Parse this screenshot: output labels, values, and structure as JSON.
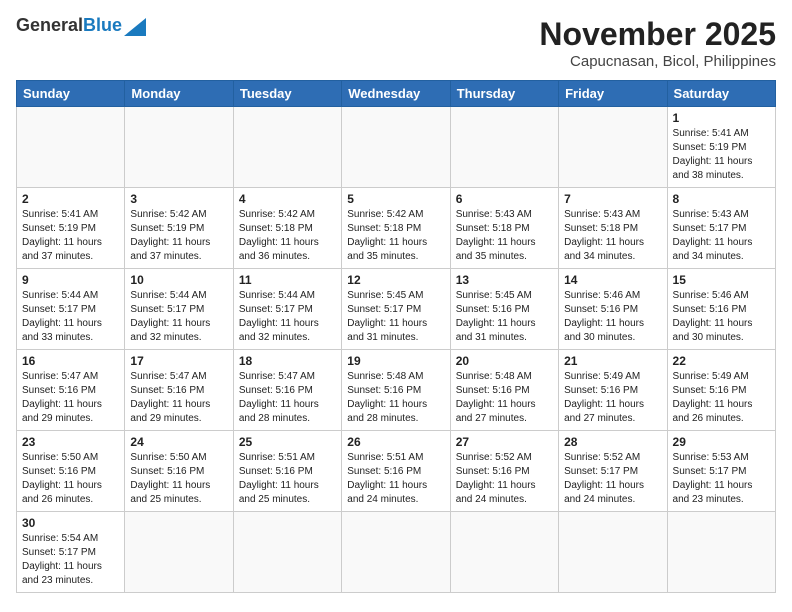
{
  "header": {
    "logo_line1": "General",
    "logo_line2": "Blue",
    "title": "November 2025",
    "subtitle": "Capucnasan, Bicol, Philippines"
  },
  "weekdays": [
    "Sunday",
    "Monday",
    "Tuesday",
    "Wednesday",
    "Thursday",
    "Friday",
    "Saturday"
  ],
  "weeks": [
    [
      {
        "day": "",
        "text": ""
      },
      {
        "day": "",
        "text": ""
      },
      {
        "day": "",
        "text": ""
      },
      {
        "day": "",
        "text": ""
      },
      {
        "day": "",
        "text": ""
      },
      {
        "day": "",
        "text": ""
      },
      {
        "day": "1",
        "text": "Sunrise: 5:41 AM\nSunset: 5:19 PM\nDaylight: 11 hours and 38 minutes."
      }
    ],
    [
      {
        "day": "2",
        "text": "Sunrise: 5:41 AM\nSunset: 5:19 PM\nDaylight: 11 hours and 37 minutes."
      },
      {
        "day": "3",
        "text": "Sunrise: 5:42 AM\nSunset: 5:19 PM\nDaylight: 11 hours and 37 minutes."
      },
      {
        "day": "4",
        "text": "Sunrise: 5:42 AM\nSunset: 5:18 PM\nDaylight: 11 hours and 36 minutes."
      },
      {
        "day": "5",
        "text": "Sunrise: 5:42 AM\nSunset: 5:18 PM\nDaylight: 11 hours and 35 minutes."
      },
      {
        "day": "6",
        "text": "Sunrise: 5:43 AM\nSunset: 5:18 PM\nDaylight: 11 hours and 35 minutes."
      },
      {
        "day": "7",
        "text": "Sunrise: 5:43 AM\nSunset: 5:18 PM\nDaylight: 11 hours and 34 minutes."
      },
      {
        "day": "8",
        "text": "Sunrise: 5:43 AM\nSunset: 5:17 PM\nDaylight: 11 hours and 34 minutes."
      }
    ],
    [
      {
        "day": "9",
        "text": "Sunrise: 5:44 AM\nSunset: 5:17 PM\nDaylight: 11 hours and 33 minutes."
      },
      {
        "day": "10",
        "text": "Sunrise: 5:44 AM\nSunset: 5:17 PM\nDaylight: 11 hours and 32 minutes."
      },
      {
        "day": "11",
        "text": "Sunrise: 5:44 AM\nSunset: 5:17 PM\nDaylight: 11 hours and 32 minutes."
      },
      {
        "day": "12",
        "text": "Sunrise: 5:45 AM\nSunset: 5:17 PM\nDaylight: 11 hours and 31 minutes."
      },
      {
        "day": "13",
        "text": "Sunrise: 5:45 AM\nSunset: 5:16 PM\nDaylight: 11 hours and 31 minutes."
      },
      {
        "day": "14",
        "text": "Sunrise: 5:46 AM\nSunset: 5:16 PM\nDaylight: 11 hours and 30 minutes."
      },
      {
        "day": "15",
        "text": "Sunrise: 5:46 AM\nSunset: 5:16 PM\nDaylight: 11 hours and 30 minutes."
      }
    ],
    [
      {
        "day": "16",
        "text": "Sunrise: 5:47 AM\nSunset: 5:16 PM\nDaylight: 11 hours and 29 minutes."
      },
      {
        "day": "17",
        "text": "Sunrise: 5:47 AM\nSunset: 5:16 PM\nDaylight: 11 hours and 29 minutes."
      },
      {
        "day": "18",
        "text": "Sunrise: 5:47 AM\nSunset: 5:16 PM\nDaylight: 11 hours and 28 minutes."
      },
      {
        "day": "19",
        "text": "Sunrise: 5:48 AM\nSunset: 5:16 PM\nDaylight: 11 hours and 28 minutes."
      },
      {
        "day": "20",
        "text": "Sunrise: 5:48 AM\nSunset: 5:16 PM\nDaylight: 11 hours and 27 minutes."
      },
      {
        "day": "21",
        "text": "Sunrise: 5:49 AM\nSunset: 5:16 PM\nDaylight: 11 hours and 27 minutes."
      },
      {
        "day": "22",
        "text": "Sunrise: 5:49 AM\nSunset: 5:16 PM\nDaylight: 11 hours and 26 minutes."
      }
    ],
    [
      {
        "day": "23",
        "text": "Sunrise: 5:50 AM\nSunset: 5:16 PM\nDaylight: 11 hours and 26 minutes."
      },
      {
        "day": "24",
        "text": "Sunrise: 5:50 AM\nSunset: 5:16 PM\nDaylight: 11 hours and 25 minutes."
      },
      {
        "day": "25",
        "text": "Sunrise: 5:51 AM\nSunset: 5:16 PM\nDaylight: 11 hours and 25 minutes."
      },
      {
        "day": "26",
        "text": "Sunrise: 5:51 AM\nSunset: 5:16 PM\nDaylight: 11 hours and 24 minutes."
      },
      {
        "day": "27",
        "text": "Sunrise: 5:52 AM\nSunset: 5:16 PM\nDaylight: 11 hours and 24 minutes."
      },
      {
        "day": "28",
        "text": "Sunrise: 5:52 AM\nSunset: 5:17 PM\nDaylight: 11 hours and 24 minutes."
      },
      {
        "day": "29",
        "text": "Sunrise: 5:53 AM\nSunset: 5:17 PM\nDaylight: 11 hours and 23 minutes."
      }
    ],
    [
      {
        "day": "30",
        "text": "Sunrise: 5:54 AM\nSunset: 5:17 PM\nDaylight: 11 hours and 23 minutes."
      },
      {
        "day": "",
        "text": ""
      },
      {
        "day": "",
        "text": ""
      },
      {
        "day": "",
        "text": ""
      },
      {
        "day": "",
        "text": ""
      },
      {
        "day": "",
        "text": ""
      },
      {
        "day": "",
        "text": ""
      }
    ]
  ]
}
